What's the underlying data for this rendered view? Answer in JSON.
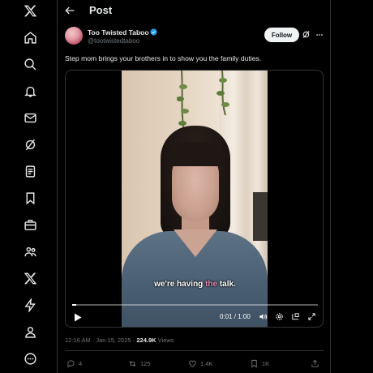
{
  "nav": {
    "items": [
      "x-logo-icon",
      "home-icon",
      "search-icon",
      "notifications-icon",
      "messages-icon",
      "grok-icon",
      "lists-icon",
      "bookmarks-icon",
      "jobs-icon",
      "communities-icon",
      "premium-icon",
      "verified-orgs-icon",
      "profile-icon",
      "more-icon"
    ]
  },
  "header": {
    "title": "Post"
  },
  "post": {
    "author_name": "Too Twisted Taboo",
    "author_handle": "@tootwistedtaboo",
    "follow_label": "Follow",
    "text": "Step mom brings your brothers in to show you the family duties.",
    "video": {
      "caption_pre": "we're having ",
      "caption_highlight": "the",
      "caption_post": " talk.",
      "time": "0:01 / 1:00",
      "progress": 0.017
    },
    "timestamp": "12:16 AM · Jan 15, 2025 · ",
    "views_count": "224.9K",
    "views_label": " Views",
    "actions": {
      "replies": "4",
      "reposts": "125",
      "likes": "1.4K",
      "bookmarks": "1K"
    }
  },
  "colors": {
    "background": "#000000",
    "text": "#e7e9ea",
    "secondary": "#71767b",
    "border": "#2f3336",
    "verified": "#1d9bf0",
    "caption_highlight": "#e58ab2"
  }
}
